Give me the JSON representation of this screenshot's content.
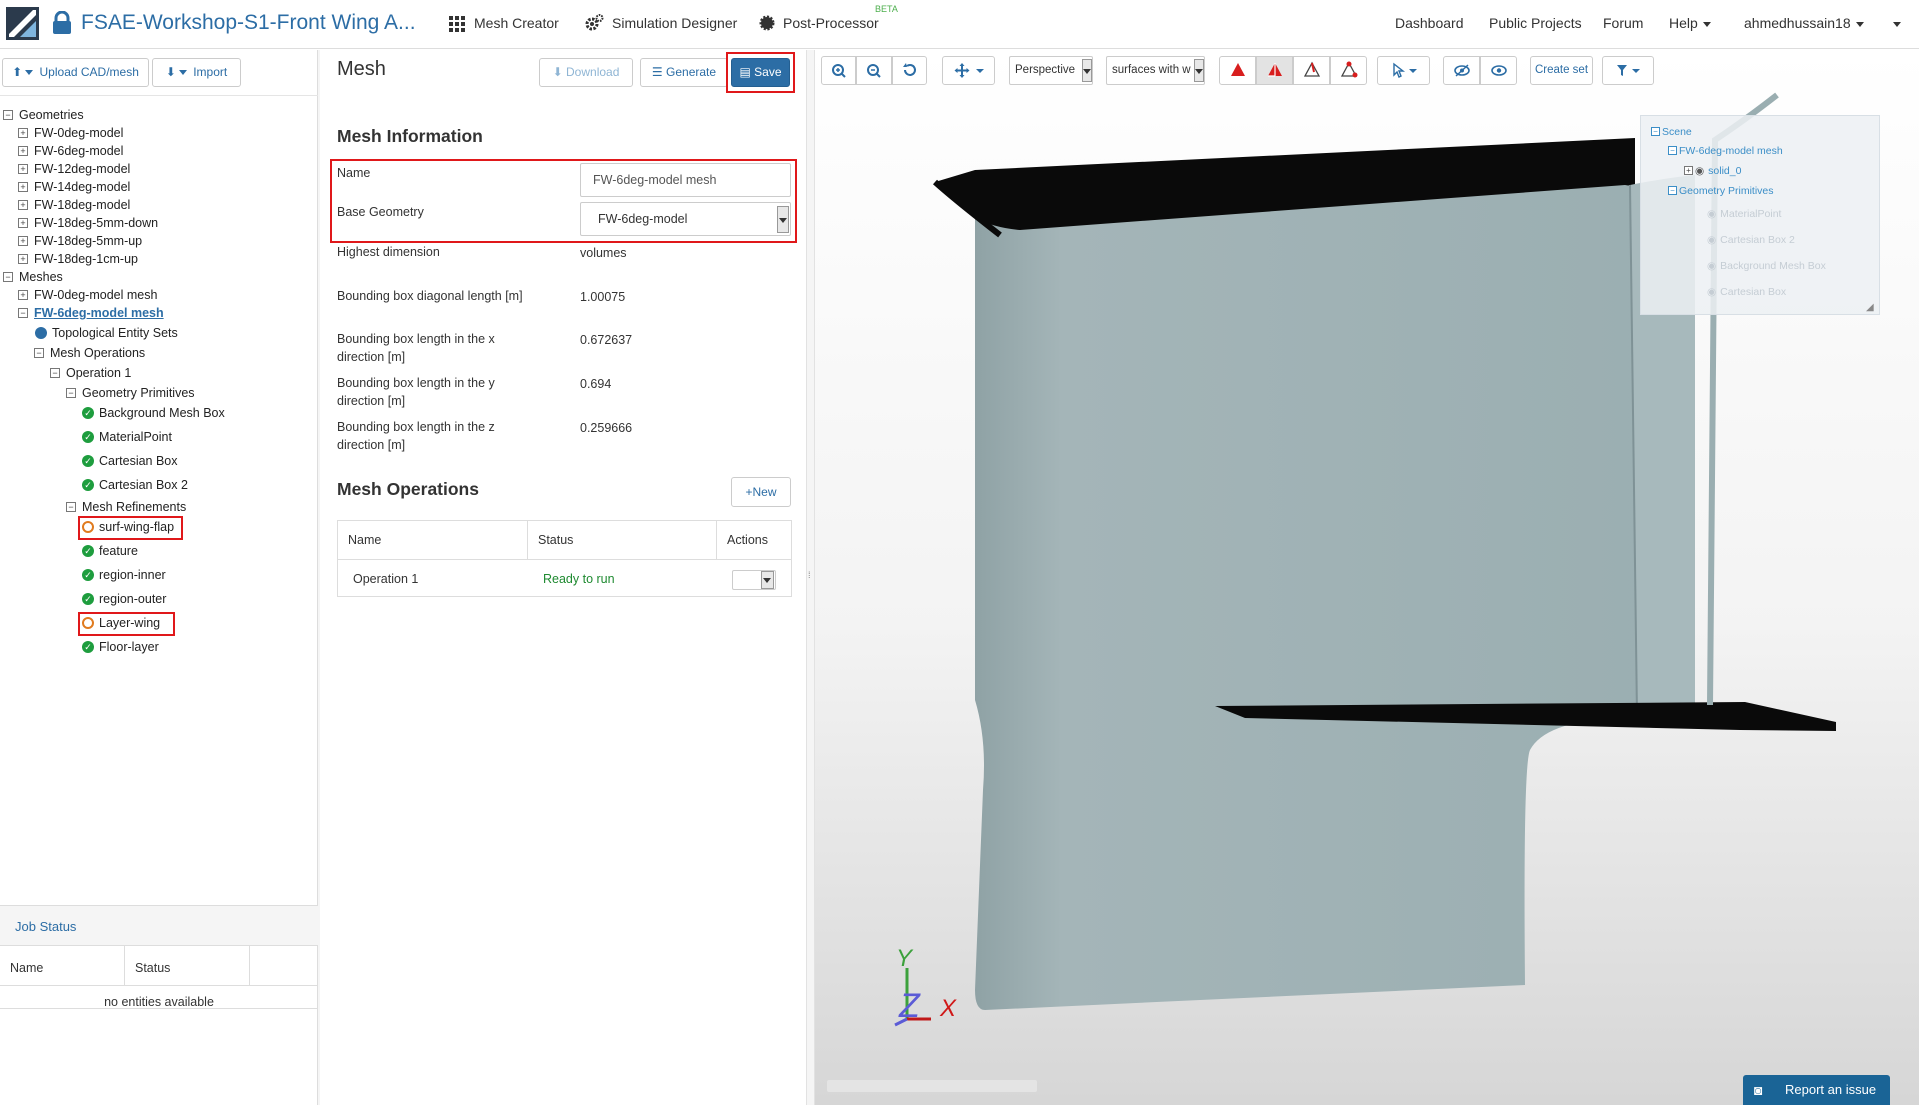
{
  "topnav": {
    "project_title": "FSAE-Workshop-S1-Front Wing A...",
    "mesh_creator": "Mesh Creator",
    "simulation_designer": "Simulation Designer",
    "post_processor": "Post-Processor",
    "beta": "BETA",
    "dashboard": "Dashboard",
    "public_projects": "Public Projects",
    "forum": "Forum",
    "help": "Help",
    "user": "ahmedhussain18"
  },
  "left": {
    "upload_label": "Upload CAD/mesh",
    "import_label": "Import",
    "tree": {
      "geometries": "Geometries",
      "geometry_items": [
        "FW-0deg-model",
        "FW-6deg-model",
        "FW-12deg-model",
        "FW-14deg-model",
        "FW-18deg-model",
        "FW-18deg-5mm-down",
        "FW-18deg-5mm-up",
        "FW-18deg-1cm-up"
      ],
      "meshes": "Meshes",
      "mesh_0": "FW-0deg-model mesh",
      "mesh_1": "FW-6deg-model mesh",
      "topological_sets": "Topological Entity Sets",
      "mesh_operations": "Mesh Operations",
      "operation_1": "Operation 1",
      "geometry_primitives": "Geometry Primitives",
      "primitives": [
        "Background Mesh Box",
        "MaterialPoint",
        "Cartesian Box",
        "Cartesian Box 2"
      ],
      "mesh_refinements": "Mesh Refinements",
      "refinements": [
        "surf-wing-flap",
        "feature",
        "region-inner",
        "region-outer",
        "Layer-wing",
        "Floor-layer"
      ]
    },
    "job_status": {
      "title": "Job Status",
      "col_name": "Name",
      "col_status": "Status",
      "empty": "no entities available"
    }
  },
  "mesh": {
    "title": "Mesh",
    "download": "Download",
    "generate": "Generate",
    "save": "Save",
    "info_title": "Mesh Information",
    "name_label": "Name",
    "name_value": "FW-6deg-model mesh",
    "base_geometry_label": "Base Geometry",
    "base_geometry_value": "FW-6deg-model",
    "highest_dim_label": "Highest dimension",
    "highest_dim_value": "volumes",
    "bbox_diag_label": "Bounding box diagonal length [m]",
    "bbox_diag_value": "1.00075",
    "bbox_x_label": "Bounding box length in the x direction [m]",
    "bbox_x_value": "0.672637",
    "bbox_y_label": "Bounding box length in the y direction [m]",
    "bbox_y_value": "0.694",
    "bbox_z_label": "Bounding box length in the z direction [m]",
    "bbox_z_value": "0.259666",
    "ops_title": "Mesh Operations",
    "new_label": "New",
    "ops_cols": [
      "Name",
      "Status",
      "Actions"
    ],
    "op_name": "Operation 1",
    "op_status": "Ready to run"
  },
  "viewer": {
    "projection": "Perspective",
    "render_mode": "surfaces with w",
    "create_set": "Create set",
    "scene": {
      "scene": "Scene",
      "mesh": "FW-6deg-model mesh",
      "solid": "solid_0",
      "primitives": "Geometry Primitives",
      "items": [
        "MaterialPoint",
        "Cartesian Box 2",
        "Background Mesh Box",
        "Cartesian Box"
      ]
    },
    "axis_y": "Y",
    "axis_z": "Z",
    "axis_x": "X",
    "report": "Report an issue"
  },
  "colors": {
    "accent": "#2c6da5",
    "ok": "#1e9d3e",
    "highlight": "#e0181a",
    "model": "#9aaeb1"
  }
}
